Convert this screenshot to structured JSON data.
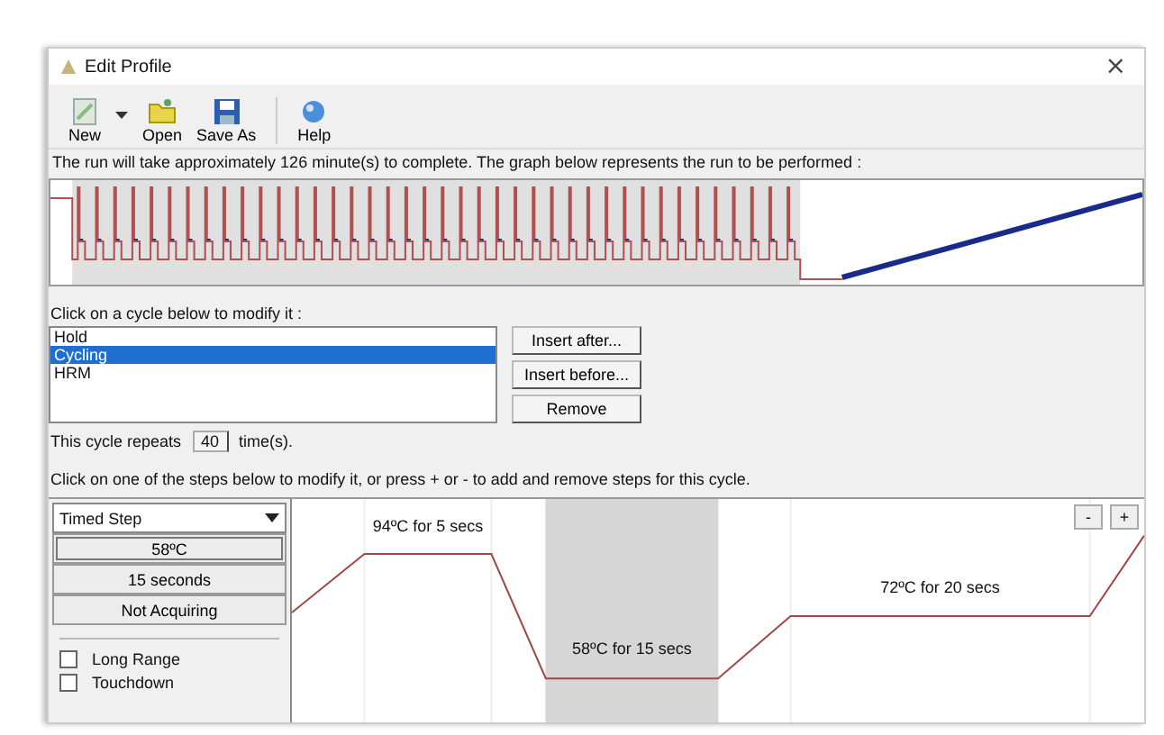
{
  "window": {
    "title": "Edit Profile",
    "close": "×"
  },
  "toolbar": [
    {
      "label": "New",
      "kind": "new",
      "dropdown": true
    },
    {
      "label": "Open",
      "kind": "open",
      "dropdown": false
    },
    {
      "label": "Save As",
      "kind": "save",
      "dropdown": false
    },
    {
      "label": "Help",
      "kind": "help",
      "dropdown": false
    }
  ],
  "run_info": "The run will take approximately 126 minute(s) to complete. The graph below represents the run to be performed :",
  "cycles_label": "Click on a cycle below to modify it :",
  "cycles": [
    {
      "label": "Hold",
      "selected": false
    },
    {
      "label": "Cycling",
      "selected": true
    },
    {
      "label": "HRM",
      "selected": false
    }
  ],
  "cycle_buttons": [
    "Insert after...",
    "Insert before...",
    "Remove"
  ],
  "repeat": {
    "before": "This cycle repeats",
    "value": "40",
    "after": "time(s)."
  },
  "steps_info": "Click on one of the steps below to modify it, or press + or - to add and remove steps for this cycle.",
  "step_editor": {
    "type": "Timed Step",
    "temperature": "58ºC",
    "time": "15 seconds",
    "acquiring": "Not Acquiring",
    "options": [
      {
        "label": "Long Range",
        "checked": false
      },
      {
        "label": "Touchdown",
        "checked": false
      }
    ]
  },
  "steps": [
    {
      "label": "94ºC for 5 secs",
      "selected": false
    },
    {
      "label": "58ºC for 15 secs",
      "selected": true
    },
    {
      "label": "72ºC for 20 secs",
      "selected": false
    }
  ],
  "zoom_buttons": [
    "-",
    "+"
  ]
}
